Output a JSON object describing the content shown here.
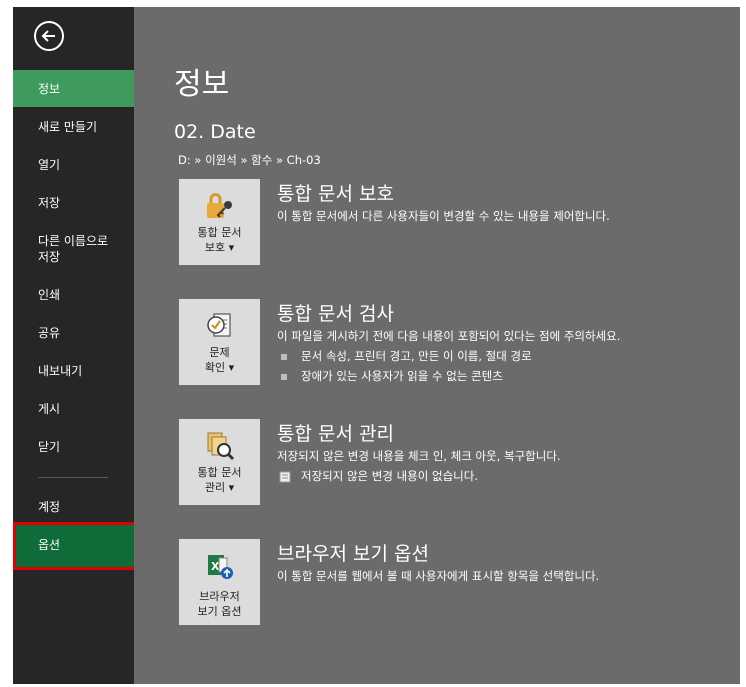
{
  "sidebar": {
    "items": [
      {
        "label": "정보"
      },
      {
        "label": "새로 만들기"
      },
      {
        "label": "열기"
      },
      {
        "label": "저장"
      },
      {
        "label": "다른 이름으로 저장"
      },
      {
        "label": "인쇄"
      },
      {
        "label": "공유"
      },
      {
        "label": "내보내기"
      },
      {
        "label": "게시"
      },
      {
        "label": "닫기"
      },
      {
        "label": "계정"
      },
      {
        "label": "옵션"
      }
    ],
    "item_5_line1": "다른 이름으로",
    "item_5_line2": "저장"
  },
  "main": {
    "title": "정보",
    "filename": "02. Date",
    "path": "D: » 이원석 » 함수 » Ch-03",
    "sections": [
      {
        "title": "통합 문서 보호",
        "desc": "이 통합 문서에서 다른 사용자들이 변경할 수 있는 내용을 제어합니다.",
        "tile_line1": "통합 문서",
        "tile_line2": "보호 ▾"
      },
      {
        "title": "통합 문서 검사",
        "desc": "이 파일을 게시하기 전에 다음 내용이 포함되어 있다는 점에 주의하세요.",
        "bullets": [
          "문서 속성, 프린터 경고, 만든 이 이름, 절대 경로",
          "장애가 있는 사용자가 읽을 수 없는 콘텐츠"
        ],
        "tile_line1": "문제",
        "tile_line2": "확인 ▾"
      },
      {
        "title": "통합 문서 관리",
        "desc": "저장되지 않은 변경 내용을 체크 인, 체크 아웃, 복구합니다.",
        "bullets": [
          "저장되지 않은 변경 내용이 없습니다."
        ],
        "tile_line1": "통합 문서",
        "tile_line2": "관리 ▾"
      },
      {
        "title": "브라우저 보기 옵션",
        "desc": "이 통합 문서를 웹에서 볼 때 사용자에게 표시할 항목을 선택합니다.",
        "tile_line1": "브라우저",
        "tile_line2": "보기 옵션"
      }
    ]
  },
  "colors": {
    "sidebar_bg": "#262626",
    "main_bg": "#6b6b6b",
    "active_item": "#3f9a5e",
    "selected_item": "#0f6b37",
    "highlight_border": "#e00000"
  },
  "icons": [
    "back-arrow-icon",
    "lock-key-icon",
    "inspect-document-icon",
    "manage-workbook-icon",
    "browser-view-icon"
  ]
}
